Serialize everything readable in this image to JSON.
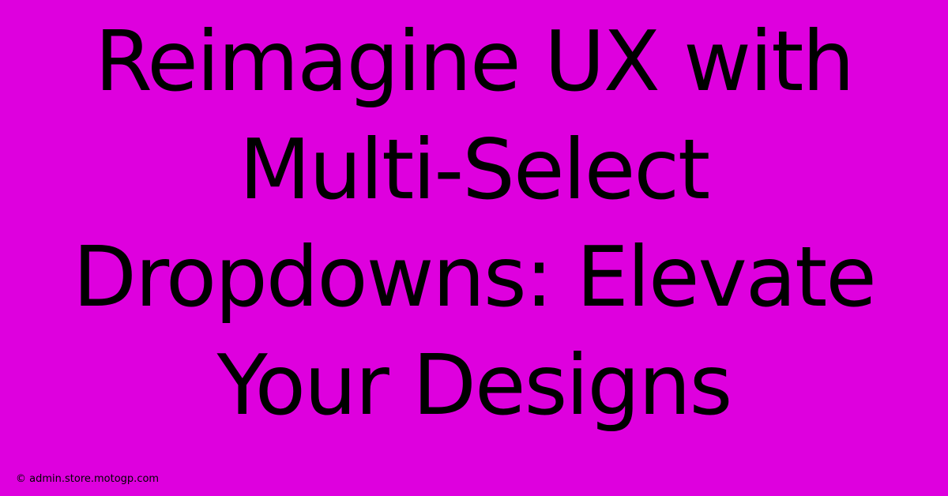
{
  "headline": "Reimagine UX with Multi-Select Dropdowns: Elevate Your Designs",
  "attribution": "© admin.store.motogp.com",
  "colors": {
    "background": "#de00de",
    "text": "#000000"
  }
}
